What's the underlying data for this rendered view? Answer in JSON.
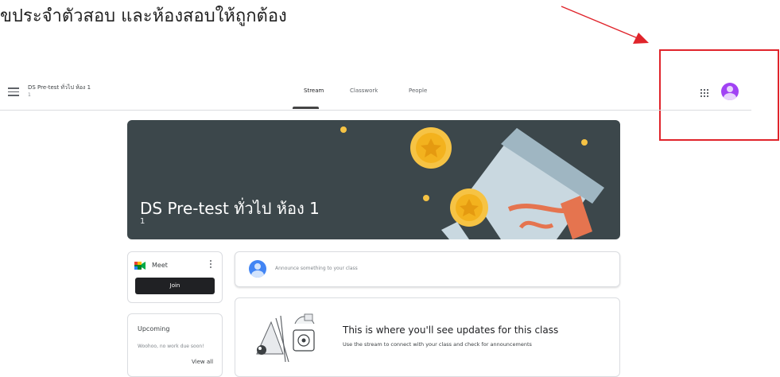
{
  "caption": "ขประจำตัวสอบ และห้องสอบให้ถูกต้อง",
  "header": {
    "class_name": "DS Pre-test ทั่วไป ห้อง 1",
    "class_section": "1",
    "tabs": [
      {
        "label": "Stream",
        "active": true
      },
      {
        "label": "Classwork",
        "active": false
      },
      {
        "label": "People",
        "active": false
      }
    ],
    "icons": {
      "menu": "hamburger-menu-icon",
      "apps": "google-apps-grid-icon",
      "avatar": "account-avatar-icon"
    }
  },
  "banner": {
    "title": "DS Pre-test ทั่วไป ห้อง 1",
    "section": "1"
  },
  "meet": {
    "label": "Meet",
    "join_label": "Join"
  },
  "upcoming": {
    "title": "Upcoming",
    "text": "Woohoo, no work due soon!",
    "view_all": "View all"
  },
  "announce": {
    "placeholder": "Announce something to your class"
  },
  "updates": {
    "title": "This is where you'll see updates for this class",
    "subtitle": "Use the stream to connect with your class and check for announcements"
  },
  "colors": {
    "annotation_red": "#e0242b",
    "banner_bg": "#3c474b",
    "avatar_purple": "#a142f4",
    "avatar_blue": "#4285f4",
    "join_button": "#202124"
  }
}
